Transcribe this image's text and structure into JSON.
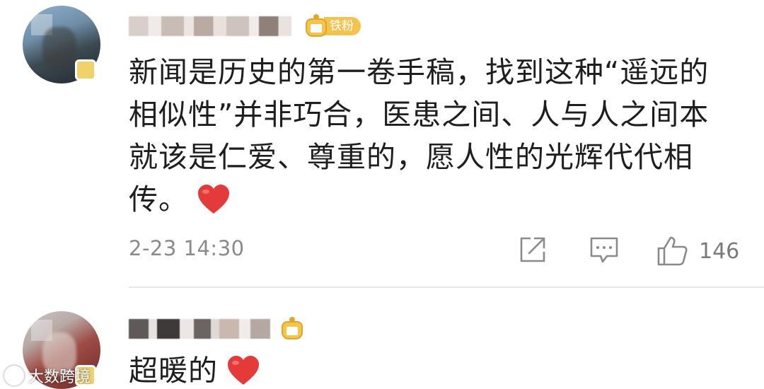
{
  "comments": [
    {
      "username_blurred": true,
      "fan_badge": "铁粉",
      "text": "新闻是历史的第一卷手稿，找到这种“遥远的相似性”并非巧合，医患之间、人与人之间本就该是仁爱、尊重的，愿人性的光辉代代相传。",
      "emoji": "heart-icon",
      "timestamp": "2-23 14:30",
      "actions": {
        "share_icon": "share-icon",
        "comment_icon": "comment-icon",
        "like_icon": "thumbs-up-icon",
        "like_count": "146"
      }
    },
    {
      "username_blurred": true,
      "text": "超暖的",
      "emoji": "heart-icon"
    }
  ],
  "watermark": {
    "text": "大数跨境"
  },
  "colors": {
    "heart": "#e53a3a",
    "fan_badge": "#f4c24e",
    "meta_text": "#8a8a8a",
    "divider": "#e6e6e6"
  }
}
